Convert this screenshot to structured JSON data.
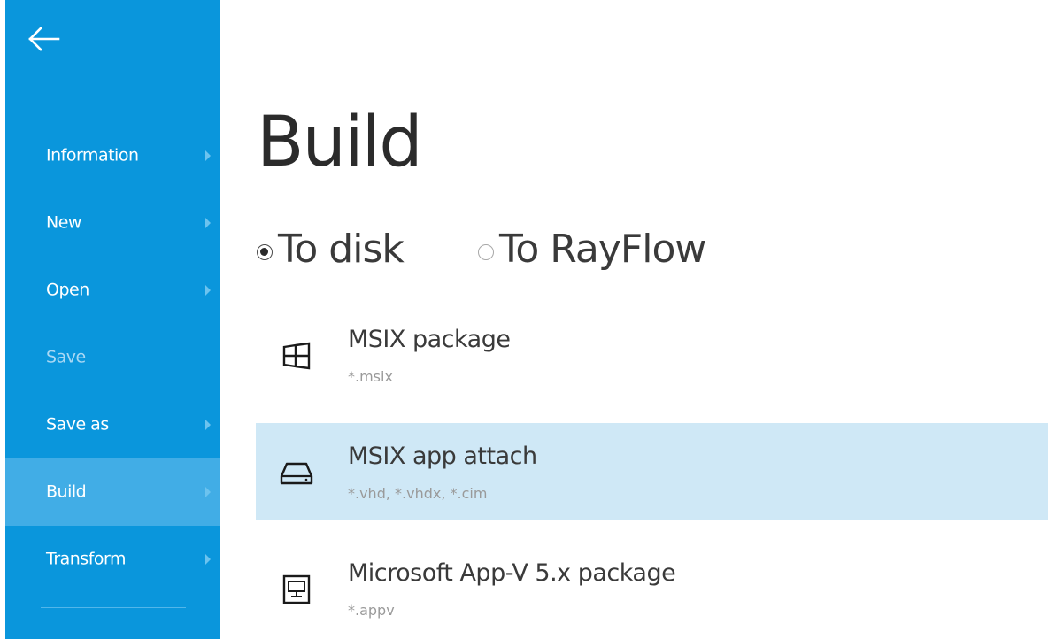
{
  "sidebar": {
    "back_icon": "arrow-left-icon",
    "colors": {
      "background": "#0a96dc",
      "active": "#41ade6",
      "disabled_text": "#a9d8f4"
    },
    "items": [
      {
        "label": "Information",
        "state": "normal"
      },
      {
        "label": "New",
        "state": "normal"
      },
      {
        "label": "Open",
        "state": "normal"
      },
      {
        "label": "Save",
        "state": "disabled"
      },
      {
        "label": "Save as",
        "state": "normal"
      },
      {
        "label": "Build",
        "state": "active"
      },
      {
        "label": "Transform",
        "state": "normal"
      }
    ]
  },
  "main": {
    "title": "Build",
    "targets": [
      {
        "label": "To disk",
        "checked": true
      },
      {
        "label": "To RayFlow",
        "checked": false
      }
    ],
    "formats": [
      {
        "name": "MSIX package",
        "extensions": "*.msix",
        "icon": "windows-logo-icon",
        "selected": false
      },
      {
        "name": "MSIX app attach",
        "extensions": "*.vhd, *.vhdx, *.cim",
        "icon": "hard-drive-icon",
        "selected": true
      },
      {
        "name": "Microsoft App-V 5.x package",
        "extensions": "*.appv",
        "icon": "virtual-desktop-icon",
        "selected": false
      }
    ],
    "colors": {
      "selected_row": "#cfe8f6"
    }
  }
}
